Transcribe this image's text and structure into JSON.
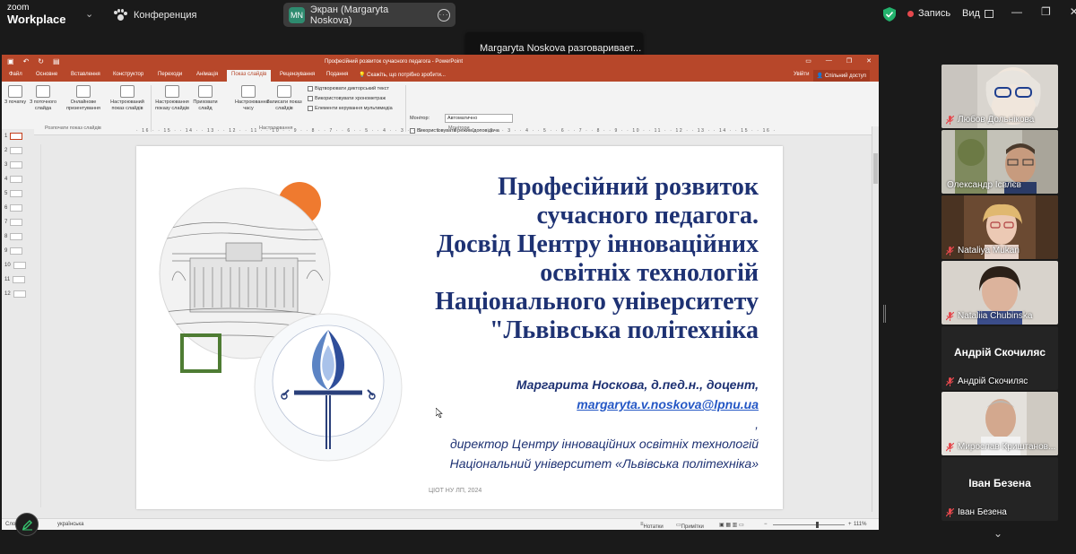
{
  "zoom": {
    "brand_line1": "zoom",
    "brand_line2": "Workplace",
    "meeting_label": "Конференция",
    "screen_share_initials": "MN",
    "screen_share_label": "Экран (Margaryta Noskova)",
    "record_label": "Запись",
    "view_label": "Вид",
    "speaking_tooltip": "Margaryta Noskova разговаривает...",
    "accent_color": "#2e8b6f",
    "record_color": "#e5484d"
  },
  "ppt": {
    "window_title": "Професійний розвиток сучасного педагога - PowerPoint",
    "tabs": [
      "Файл",
      "Основне",
      "Вставлення",
      "Конструктор",
      "Переходи",
      "Анімація",
      "Показ слайдів",
      "Рецензування",
      "Подання"
    ],
    "tell_me": "Скажіть, що потрібно зробити...",
    "sign_in": "Увійти",
    "share": "Спільний доступ",
    "ribbon": {
      "from_start": "З початку",
      "from_current": "З поточного слайда",
      "online": "Онлайнове презентування",
      "custom": "Настроюваний показ слайдів",
      "group1": "Розпочати показ слайдів",
      "setup": "Настроювання показу слайдів",
      "hide": "Приховати слайд",
      "rehearse": "Настроювання часу",
      "record": "Записати показ слайдів",
      "cb_narration": "Відтворювати дикторський текст",
      "cb_timings": "Використовувати хронометраж",
      "cb_media": "Елементи керування мультимедіа",
      "group2": "Настроювання",
      "monitor_label": "Монітор:",
      "monitor_value": "Автоматично",
      "presenter_view": "Використовувати режим доповідача",
      "group3": "Монітори"
    },
    "ruler": "· 16 · · 15 · · 14 · · 13 · · 12 · · 11 · · 10 · · 9 · · 8 · · 7 · · 6 · · 5 · · 4 · · 3 · · 2 · · 1 · · 0 · · 1 · · 2 · · 3 · · 4 · · 5 · · 6 · · 7 · · 8 · · 9 · · 10 · · 11 · · 12 · · 13 · · 14 · · 15 · · 16 ·",
    "thumbnails": [
      "1",
      "2",
      "3",
      "4",
      "5",
      "6",
      "7",
      "8",
      "9",
      "10",
      "11",
      "12"
    ],
    "status_slide": "Сло",
    "status_lang": "українська",
    "status_notes": "Нотатки",
    "status_comments": "Примітки",
    "status_zoom": "111%"
  },
  "slide": {
    "title_lines": [
      "Професійний розвиток",
      "сучасного педагога.",
      "Досвід Центру інноваційних",
      "освітніх технологій",
      "Національного університету",
      "\"Львівська політехніка"
    ],
    "author": "Маргарита Носкова, д.пед.н., доцент,",
    "email": "margaryta.v.noskova@lpnu.ua",
    "email_suffix": ",",
    "role": "директор Центру інноваційних освітніх технологій",
    "university": "Національний університет «Львівська політехніка»",
    "footer": "ЦІОТ НУ ЛП, 2024",
    "logo_ring_text": "ЛЬВІВСЬКА ПОЛІТЕХНІКА · ЦЕНТР ІННОВАЦІЙНИХ ОСВІТНІХ ТЕХНОЛОГІЙ",
    "orange_color": "#ef7a2f",
    "green_color": "#4e7c33",
    "title_color": "#1e3273"
  },
  "participants": [
    {
      "name": "Любов Дольнікова",
      "type": "video"
    },
    {
      "name": "Олександр Ісвлєв",
      "type": "video"
    },
    {
      "name": "Nataliya Mukan",
      "type": "video"
    },
    {
      "name": "Nataliia Chubinska",
      "type": "video"
    },
    {
      "name": "Андрій Скочиляс",
      "type": "name"
    },
    {
      "name": "Мирослав Криштанов...",
      "type": "video"
    },
    {
      "name": "Іван Безена",
      "type": "name"
    }
  ]
}
